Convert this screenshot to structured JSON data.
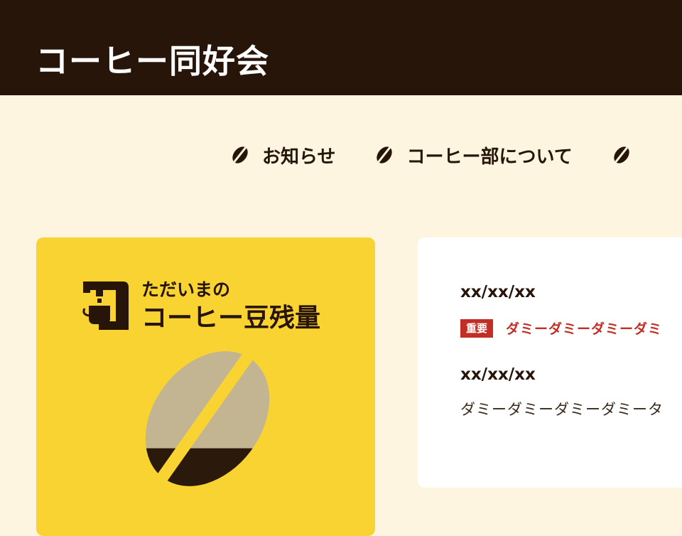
{
  "header": {
    "title": "コーヒー同好会",
    "background": "#261508"
  },
  "nav": {
    "items": [
      {
        "label": "お知らせ",
        "icon": "coffee-bean-icon"
      },
      {
        "label": "コーヒー部について",
        "icon": "coffee-bean-icon"
      }
    ]
  },
  "remaining": {
    "label_line1": "ただいまの",
    "label_line2": "コーヒー豆残量",
    "icon": "coffee-machine-icon",
    "level": 0.3,
    "colors": {
      "card": "#f9d332",
      "bean_empty": "#c4b592",
      "bean_full": "#2b1a0c"
    }
  },
  "news": {
    "items": [
      {
        "date": "xx/xx/xx",
        "badge": "重要",
        "title": "ダミーダミーダミーダミ"
      },
      {
        "date": "xx/xx/xx",
        "title": "ダミーダミーダミーダミータ"
      }
    ],
    "accent": "#c22e25"
  }
}
